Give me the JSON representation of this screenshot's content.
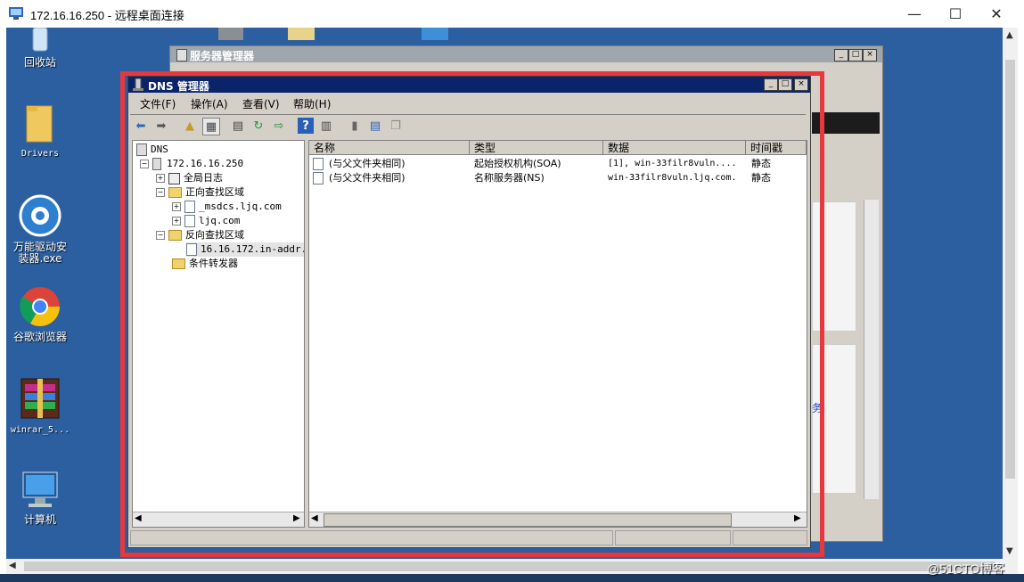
{
  "rdp": {
    "title": "172.16.16.250 - 远程桌面连接",
    "minimize": "—",
    "maximize": "☐",
    "close": "✕"
  },
  "desktop": {
    "icons": [
      {
        "label": "回收站",
        "icon": "recycle-bin-icon"
      },
      {
        "label": "Drivers",
        "icon": "folder-icon"
      },
      {
        "label": "万能驱动安装器.exe",
        "icon": "gear-icon"
      },
      {
        "label": "谷歌浏览器",
        "icon": "chrome-icon"
      },
      {
        "label": "winrar_5...",
        "icon": "winrar-icon"
      },
      {
        "label": "计算机",
        "icon": "computer-icon"
      }
    ]
  },
  "server_manager": {
    "title": "服务器管理器",
    "partial_text": "务"
  },
  "dns": {
    "title": "DNS 管理器",
    "menu": [
      "文件(F)",
      "操作(A)",
      "查看(V)",
      "帮助(H)"
    ],
    "tree": {
      "root": "DNS",
      "server": "172.16.16.250",
      "global_logs": "全局日志",
      "forward_zones": "正向查找区域",
      "fz_msdcs": "_msdcs.ljq.com",
      "fz_ljq": "ljq.com",
      "reverse_zones": "反向查找区域",
      "rz_zone": "16.16.172.in-addr.a",
      "conditional_forwarders": "条件转发器"
    },
    "columns": [
      "名称",
      "类型",
      "数据",
      "时间戳"
    ],
    "rows": [
      {
        "name": "(与父文件夹相同)",
        "type": "起始授权机构(SOA)",
        "data": "[1], win-33filr8vuln....",
        "timestamp": "静态"
      },
      {
        "name": "(与父文件夹相同)",
        "type": "名称服务器(NS)",
        "data": "win-33filr8vuln.ljq.com.",
        "timestamp": "静态"
      }
    ]
  },
  "watermark": "@51CTO博客"
}
